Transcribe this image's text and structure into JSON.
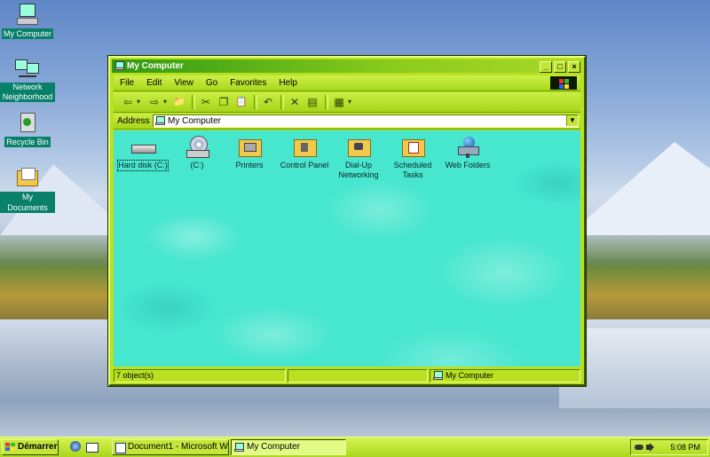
{
  "desktop": {
    "icons": [
      {
        "label": "My Computer",
        "icon": "computer-icon"
      },
      {
        "label": "Network Neighborhood",
        "icon": "network-icon"
      },
      {
        "label": "Recycle Bin",
        "icon": "recycle-bin-icon"
      },
      {
        "label": "My Documents",
        "icon": "folder-icon"
      }
    ]
  },
  "window": {
    "title": "My Computer",
    "buttons": {
      "minimize": "_",
      "maximize": "□",
      "close": "×"
    },
    "menu": [
      "File",
      "Edit",
      "View",
      "Go",
      "Favorites",
      "Help"
    ],
    "toolbar": {
      "back": "⇦",
      "back_drop": "▾",
      "forward": "⇨",
      "forward_drop": "▾",
      "up": "📁",
      "cut": "✂",
      "copy": "❐",
      "paste": "📋",
      "undo": "↶",
      "delete": "✕",
      "properties": "▤",
      "views": "▦",
      "views_drop": "▾"
    },
    "address": {
      "label": "Address",
      "value": "My Computer",
      "dropdown": "▼"
    },
    "items": [
      {
        "label": "Hard disk (C:)",
        "icon": "hard-disk-icon",
        "selected": true
      },
      {
        "label": "(C:)",
        "icon": "cd-drive-icon",
        "selected": false
      },
      {
        "label": "Printers",
        "icon": "printers-folder-icon",
        "selected": false
      },
      {
        "label": "Control Panel",
        "icon": "control-panel-folder-icon",
        "selected": false
      },
      {
        "label": "Dial-Up Networking",
        "icon": "dialup-folder-icon",
        "selected": false
      },
      {
        "label": "Scheduled Tasks",
        "icon": "scheduled-tasks-folder-icon",
        "selected": false
      },
      {
        "label": "Web Folders",
        "icon": "web-folders-icon",
        "selected": false
      }
    ],
    "status": {
      "count": "7 object(s)",
      "location": "My Computer"
    }
  },
  "taskbar": {
    "start_label": "Démarrer",
    "tasks": [
      {
        "label": "Document1 - Microsoft W...",
        "active": false
      },
      {
        "label": "My Computer",
        "active": true
      }
    ],
    "clock": "5:08 PM"
  },
  "colors": {
    "theme_accent": "#b9e021",
    "content_bg": "#46e6cf",
    "title_gradient_start": "#2f9a12"
  }
}
